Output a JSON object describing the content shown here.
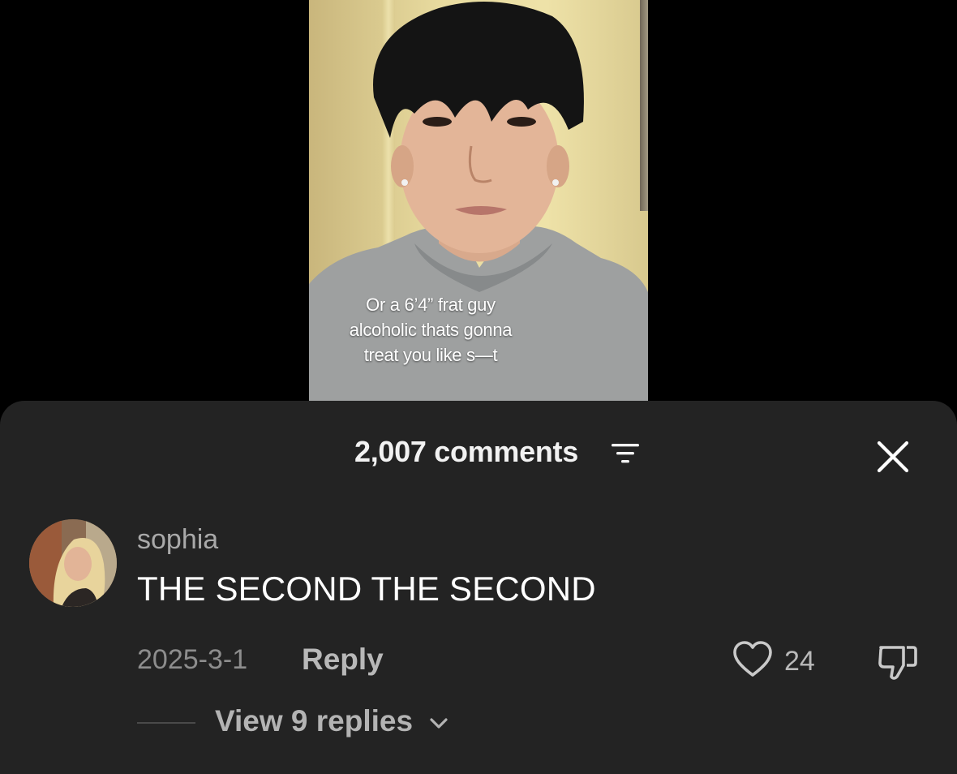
{
  "video": {
    "caption_lines": [
      "Or a 6’4” frat guy",
      "alcoholic thats gonna",
      "treat you like s—t"
    ]
  },
  "sheet": {
    "comment_count_label": "2,007 comments",
    "filter_icon": "filter-lines-icon",
    "close_icon": "close-x-icon"
  },
  "comment": {
    "username": "sophia",
    "text": "THE SECOND THE SECOND",
    "date": "2025-3-1",
    "reply_label": "Reply",
    "like_count": "24",
    "like_icon": "heart-outline-icon",
    "dislike_icon": "thumbs-down-icon",
    "view_replies_label": "View 9 replies",
    "view_replies_icon": "chevron-down-icon"
  },
  "colors": {
    "sheet_bg": "#232323",
    "page_bg": "#000000",
    "primary_text": "#ffffff",
    "secondary_text": "#a9a9a9"
  }
}
